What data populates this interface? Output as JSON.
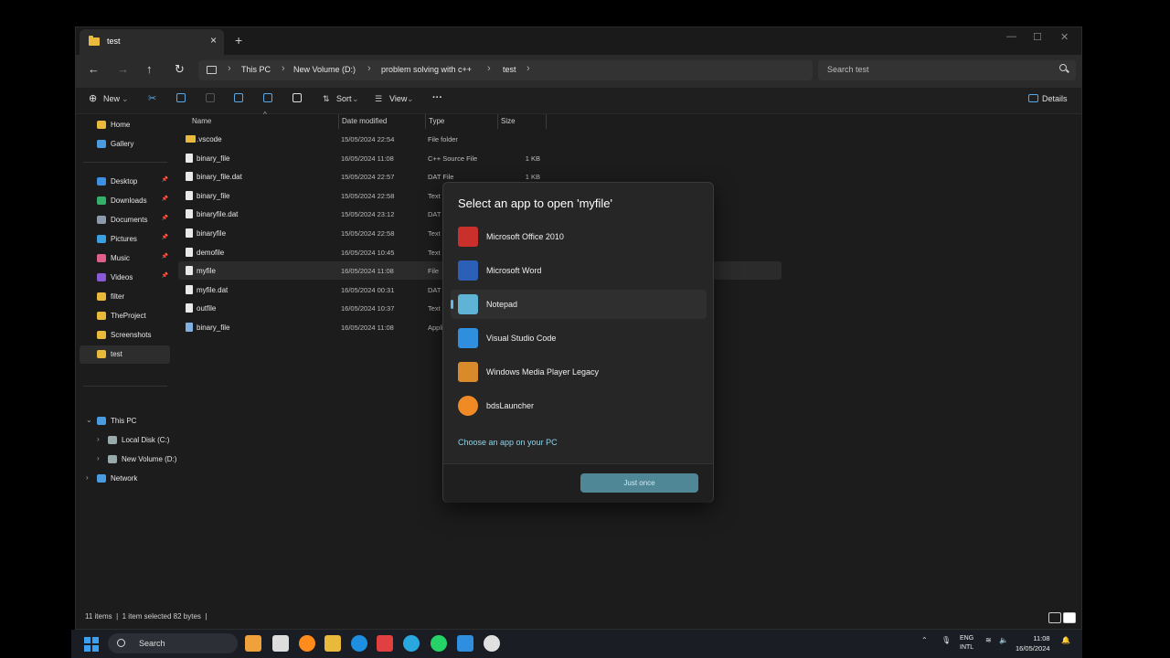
{
  "window": {
    "tab_title": "test",
    "tab_close": "×",
    "new_tab": "+",
    "controls": {
      "minimize": "—",
      "maximize": "☐",
      "close": "✕"
    }
  },
  "nav": {
    "back": "←",
    "forward": "→",
    "up": "↑",
    "refresh": "↻",
    "breadcrumbs": [
      "This PC",
      "New Volume (D:)",
      "problem solving with c++",
      "test"
    ],
    "separator": "›",
    "search_placeholder": "Search test"
  },
  "toolbar": {
    "new_label": "New",
    "sort_label": "Sort",
    "view_label": "View",
    "more_label": "···",
    "details_label": "Details"
  },
  "sidebar": {
    "quick": [
      {
        "label": "Home",
        "color": "#e8b93b"
      },
      {
        "label": "Gallery",
        "color": "#4a9be0"
      }
    ],
    "pinned": [
      {
        "label": "Desktop",
        "color": "#3d8fe0",
        "pin": "📌"
      },
      {
        "label": "Downloads",
        "color": "#35b06b",
        "pin": "📌"
      },
      {
        "label": "Documents",
        "color": "#8c9aab",
        "pin": "📌"
      },
      {
        "label": "Pictures",
        "color": "#3aa0e0",
        "pin": "📌"
      },
      {
        "label": "Music",
        "color": "#e0608a",
        "pin": "📌"
      },
      {
        "label": "Videos",
        "color": "#8a5ad6",
        "pin": "📌"
      },
      {
        "label": "filter",
        "color": "#e8b93b",
        "pin": ""
      },
      {
        "label": "TheProject",
        "color": "#e8b93b",
        "pin": ""
      },
      {
        "label": "Screenshots",
        "color": "#e8b93b",
        "pin": ""
      },
      {
        "label": "test",
        "color": "#e8b93b",
        "pin": ""
      }
    ],
    "tree": [
      {
        "label": "This PC",
        "chev": "⌄"
      },
      {
        "label": "Local Disk (C:)",
        "chev": "›"
      },
      {
        "label": "New Volume (D:)",
        "chev": "›"
      },
      {
        "label": "Network",
        "chev": "›"
      }
    ]
  },
  "columns": {
    "name": "Name",
    "date": "Date modified",
    "type": "Type",
    "size": "Size"
  },
  "files": [
    {
      "name": ".vscode",
      "date": "15/05/2024 22:54",
      "type": "File folder",
      "size": "",
      "kind": "folder"
    },
    {
      "name": "binary_file",
      "date": "16/05/2024 11:08",
      "type": "C++ Source File",
      "size": "1 KB",
      "kind": "file"
    },
    {
      "name": "binary_file.dat",
      "date": "15/05/2024 22:57",
      "type": "DAT File",
      "size": "1 KB",
      "kind": "file"
    },
    {
      "name": "binary_file",
      "date": "15/05/2024 22:58",
      "type": "Text Document",
      "size": "",
      "kind": "file"
    },
    {
      "name": "binaryfile.dat",
      "date": "15/05/2024 23:12",
      "type": "DAT File",
      "size": "",
      "kind": "file"
    },
    {
      "name": "binaryfile",
      "date": "15/05/2024 22:58",
      "type": "Text Document",
      "size": "",
      "kind": "file"
    },
    {
      "name": "demofile",
      "date": "16/05/2024 10:45",
      "type": "Text Document",
      "size": "",
      "kind": "file"
    },
    {
      "name": "myfile",
      "date": "16/05/2024 11:08",
      "type": "File",
      "size": "",
      "kind": "file"
    },
    {
      "name": "myfile.dat",
      "date": "16/05/2024 00:31",
      "type": "DAT File",
      "size": "",
      "kind": "file"
    },
    {
      "name": "outfile",
      "date": "16/05/2024 10:37",
      "type": "Text Document",
      "size": "",
      "kind": "file"
    },
    {
      "name": "binary_file",
      "date": "16/05/2024 11:08",
      "type": "Application",
      "size": "",
      "kind": "app"
    }
  ],
  "status": {
    "count": "11 items",
    "sep": "|",
    "selection": "1 item selected  82 bytes"
  },
  "dialog": {
    "title": "Select an app to open 'myfile'",
    "apps": [
      {
        "label": "Microsoft Office 2010",
        "color": "#c9302c"
      },
      {
        "label": "Microsoft Word",
        "color": "#2b5fb8"
      },
      {
        "label": "Notepad",
        "color": "#5fb4d6"
      },
      {
        "label": "Visual Studio Code",
        "color": "#2f8fde"
      },
      {
        "label": "Windows Media Player Legacy",
        "color": "#d98a2b"
      },
      {
        "label": "bdsLauncher",
        "color": "#f08a24"
      }
    ],
    "choose_link": "Choose an app on your PC",
    "just_once": "Just once"
  },
  "taskbar": {
    "search_label": "Search",
    "lang_top": "ENG",
    "lang_bottom": "INTL",
    "time": "11:08",
    "date": "16/05/2024",
    "apps": [
      "#f0a23a",
      "#ddd",
      "#ff8c1a",
      "#e8b93b",
      "#1e8fe0",
      "#e04040",
      "#2aa7df",
      "#25d366",
      "#2f8fde",
      "#e0e0e0"
    ]
  }
}
